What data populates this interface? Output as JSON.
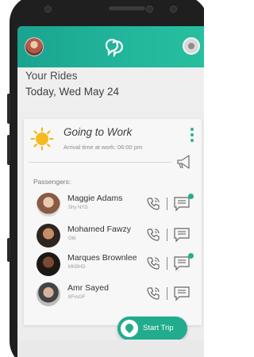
{
  "app": {
    "header": {
      "section_title": "Your Rides",
      "date": "Today, Wed May 24"
    },
    "trip": {
      "title": "Going to Work",
      "arrival": "Arrival time at work: 06:00 pm",
      "passengers_label": "Passengers:",
      "start_label": "Start Trip"
    },
    "passengers": [
      {
        "name": "Maggie Adams",
        "code": "Shy NYD",
        "unread": true
      },
      {
        "name": "Mohamed Fawzy",
        "code": "Old",
        "unread": false
      },
      {
        "name": "Marques Brownlee",
        "code": "MKBHD",
        "unread": true
      },
      {
        "name": "Amr Sayed",
        "code": "8FvsGF",
        "unread": false
      }
    ]
  },
  "colors": {
    "brand": "#22b59b",
    "accent": "#21ac8d",
    "unread_dot": "#21b08f"
  },
  "icons": [
    "profile-avatar",
    "app-logo-icon",
    "settings-icon",
    "sun-icon",
    "more-vert-icon",
    "megaphone-icon",
    "phone-icon",
    "chat-icon",
    "location-pin-icon"
  ]
}
